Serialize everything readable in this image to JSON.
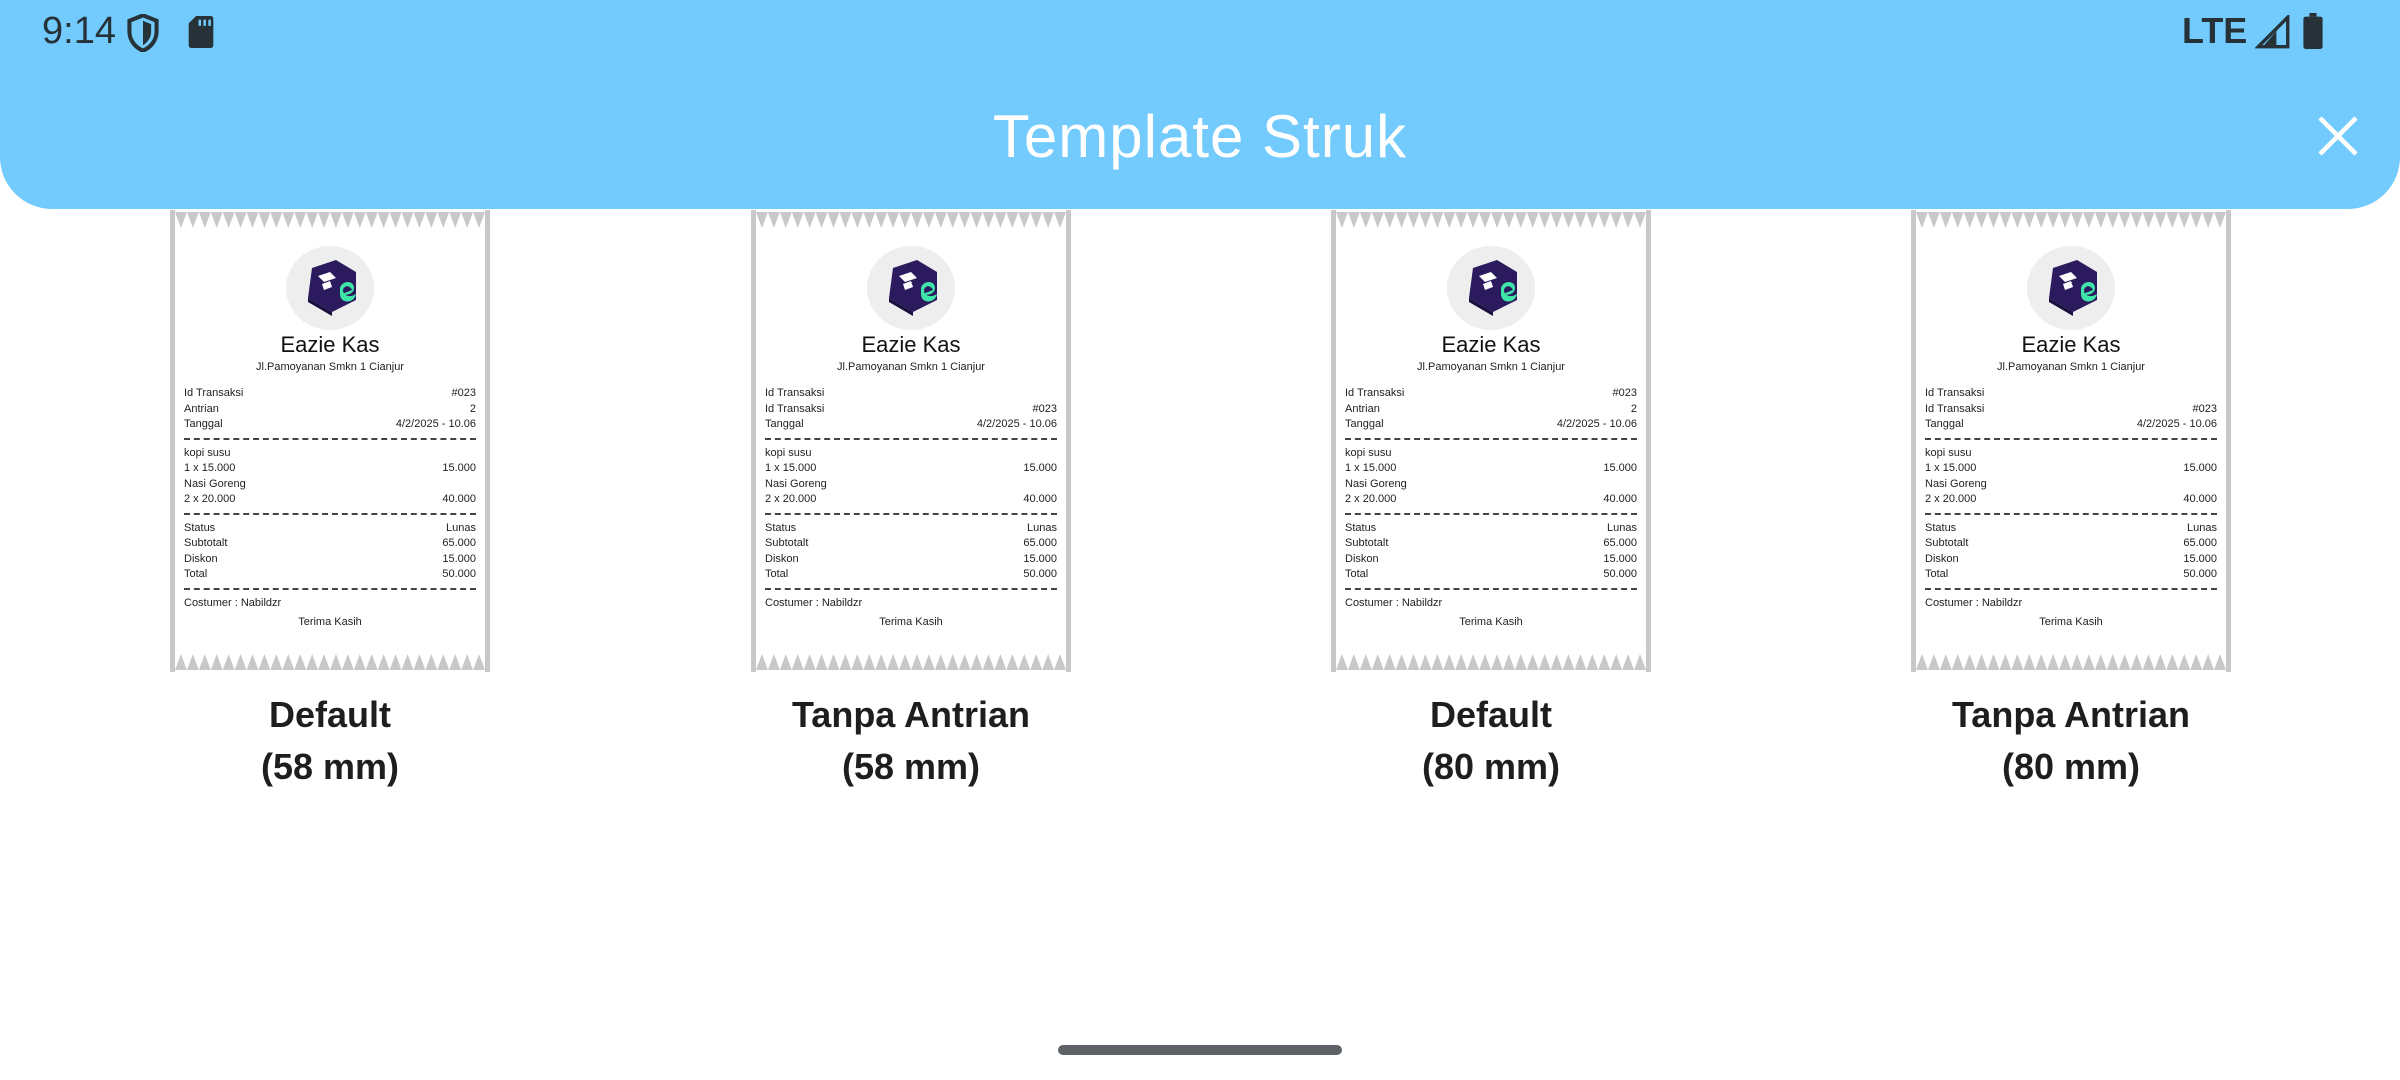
{
  "status_bar": {
    "time": "9:14",
    "network": "LTE"
  },
  "header": {
    "title": "Template Struk"
  },
  "templates": [
    {
      "label_line1": "Default",
      "label_line2": "(58 mm)",
      "receipt": {
        "store_name": "Eazie Kas",
        "address": "Jl.Pamoyanan Smkn 1 Cianjur",
        "info_rows": [
          {
            "left": "Id Transaksi",
            "right": "#023"
          },
          {
            "left": "Antrian",
            "right": "2"
          },
          {
            "left": "Tanggal",
            "right": "4/2/2025 - 10.06"
          }
        ],
        "item_rows": [
          {
            "left": "kopi susu",
            "right": ""
          },
          {
            "left": "1 x 15.000",
            "right": "15.000"
          },
          {
            "left": "Nasi Goreng",
            "right": ""
          },
          {
            "left": "2 x 20.000",
            "right": "40.000"
          }
        ],
        "summary_rows": [
          {
            "left": "Status",
            "right": "Lunas"
          },
          {
            "left": "Subtotalt",
            "right": "65.000"
          },
          {
            "left": "Diskon",
            "right": "15.000"
          },
          {
            "left": "Total",
            "right": "50.000"
          }
        ],
        "costumer": "Costumer : Nabildzr",
        "thanks": "Terima Kasih"
      }
    },
    {
      "label_line1": "Tanpa Antrian",
      "label_line2": "(58 mm)",
      "receipt": {
        "store_name": "Eazie Kas",
        "address": "Jl.Pamoyanan Smkn 1 Cianjur",
        "info_rows": [
          {
            "left": "Id Transaksi",
            "right": ""
          },
          {
            "left": "Id Transaksi",
            "right": "#023"
          },
          {
            "left": "Tanggal",
            "right": "4/2/2025 - 10.06"
          }
        ],
        "item_rows": [
          {
            "left": "kopi susu",
            "right": ""
          },
          {
            "left": "1 x 15.000",
            "right": "15.000"
          },
          {
            "left": "Nasi Goreng",
            "right": ""
          },
          {
            "left": "2 x 20.000",
            "right": "40.000"
          }
        ],
        "summary_rows": [
          {
            "left": "Status",
            "right": "Lunas"
          },
          {
            "left": "Subtotalt",
            "right": "65.000"
          },
          {
            "left": "Diskon",
            "right": "15.000"
          },
          {
            "left": "Total",
            "right": "50.000"
          }
        ],
        "costumer": "Costumer : Nabildzr",
        "thanks": "Terima Kasih"
      }
    },
    {
      "label_line1": "Default",
      "label_line2": "(80 mm)",
      "receipt": {
        "store_name": "Eazie Kas",
        "address": "Jl.Pamoyanan Smkn 1 Cianjur",
        "info_rows": [
          {
            "left": "Id Transaksi",
            "right": "#023"
          },
          {
            "left": "Antrian",
            "right": "2"
          },
          {
            "left": "Tanggal",
            "right": "4/2/2025 - 10.06"
          }
        ],
        "item_rows": [
          {
            "left": "kopi susu",
            "right": ""
          },
          {
            "left": "1 x 15.000",
            "right": "15.000"
          },
          {
            "left": "Nasi Goreng",
            "right": ""
          },
          {
            "left": "2 x 20.000",
            "right": "40.000"
          }
        ],
        "summary_rows": [
          {
            "left": "Status",
            "right": "Lunas"
          },
          {
            "left": "Subtotalt",
            "right": "65.000"
          },
          {
            "left": "Diskon",
            "right": "15.000"
          },
          {
            "left": "Total",
            "right": "50.000"
          }
        ],
        "costumer": "Costumer : Nabildzr",
        "thanks": "Terima Kasih"
      }
    },
    {
      "label_line1": "Tanpa Antrian",
      "label_line2": "(80 mm)",
      "receipt": {
        "store_name": "Eazie Kas",
        "address": "Jl.Pamoyanan Smkn 1 Cianjur",
        "info_rows": [
          {
            "left": "Id Transaksi",
            "right": ""
          },
          {
            "left": "Id Transaksi",
            "right": "#023"
          },
          {
            "left": "Tanggal",
            "right": "4/2/2025 - 10.06"
          }
        ],
        "item_rows": [
          {
            "left": "kopi susu",
            "right": ""
          },
          {
            "left": "1 x 15.000",
            "right": "15.000"
          },
          {
            "left": "Nasi Goreng",
            "right": ""
          },
          {
            "left": "2 x 20.000",
            "right": "40.000"
          }
        ],
        "summary_rows": [
          {
            "left": "Status",
            "right": "Lunas"
          },
          {
            "left": "Subtotalt",
            "right": "65.000"
          },
          {
            "left": "Diskon",
            "right": "15.000"
          },
          {
            "left": "Total",
            "right": "50.000"
          }
        ],
        "costumer": "Costumer : Nabildzr",
        "thanks": "Terima Kasih"
      }
    }
  ],
  "icons": {
    "status": [
      "shield-icon",
      "sd-card-icon",
      "signal-icon",
      "battery-icon"
    ],
    "header": [
      "close-icon"
    ],
    "logo": "eazie-kas-logo"
  },
  "colors": {
    "header_bg": "#72cbfc",
    "title_text": "#ffffff",
    "logo_dark": "#2b1a5e",
    "logo_accent": "#3ee6a8",
    "paper_border": "#c8c8c8"
  }
}
